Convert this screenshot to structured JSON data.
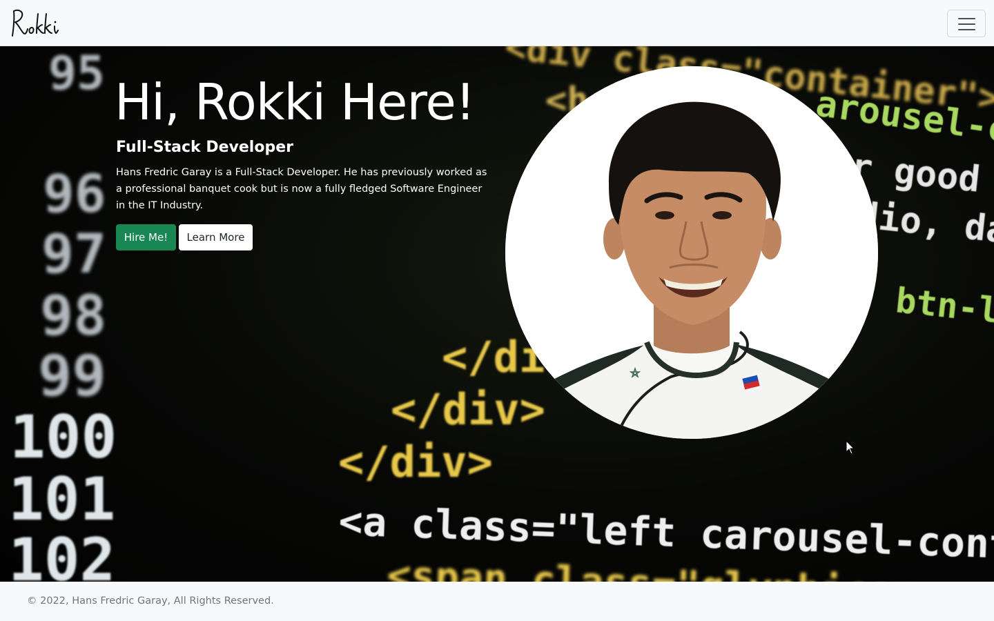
{
  "navbar": {
    "brand": "Rokki",
    "toggler_icon": "hamburger-menu-icon"
  },
  "hero": {
    "title": "Hi, Rokki Here!",
    "subtitle": "Full-Stack Developer",
    "description": "Hans Fredric Garay is a Full-Stack Developer. He has previously worked as a professional banquet cook but is now a fully fledged Software Engineer in the IT Industry.",
    "buttons": {
      "hire_label": "Hire Me!",
      "learn_label": "Learn More"
    },
    "background_code": {
      "line_numbers": [
        "95",
        "96",
        "97",
        "98",
        "99",
        "100",
        "101",
        "102"
      ],
      "snippets": [
        "<div class=\"container\">",
        "<h",
        "arousel-capt",
        "or good n",
        "dio, dap",
        "btn-lg",
        "</div>",
        "</div>",
        "</div>",
        "<a class=\"left carousel-control",
        "<span class=\"glyphicon"
      ]
    },
    "portrait": {
      "alt": "Portrait of Hans Fredric Garay in a chef jacket"
    }
  },
  "footer": {
    "copyright": "© 2022, Hans Fredric Garay, All Rights Reserved."
  },
  "colors": {
    "primary_button": "#198754",
    "secondary_button": "#ffffff",
    "navbar_bg": "#f8f9fa",
    "code_green": "#a8d860",
    "code_yellow": "#e8c84a",
    "code_white": "#e6e6e6"
  }
}
